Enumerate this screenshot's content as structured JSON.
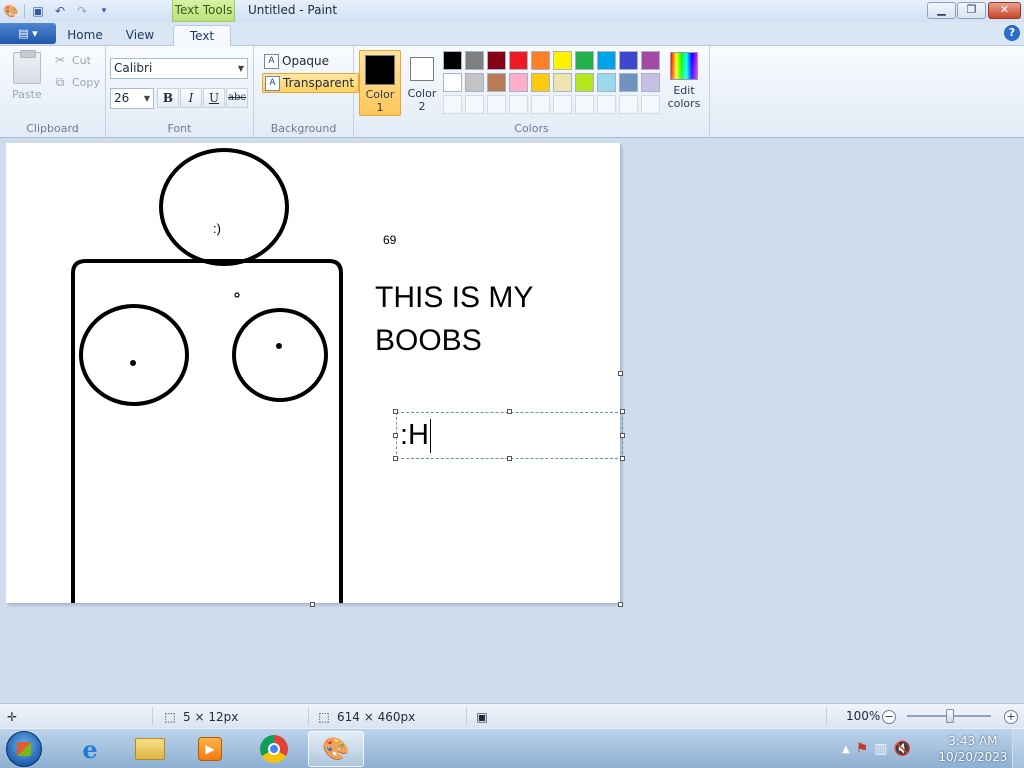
{
  "window": {
    "title": "Untitled - Paint",
    "contextual_tab": "Text Tools"
  },
  "tabs": [
    {
      "label": "Home"
    },
    {
      "label": "View"
    },
    {
      "label": "Text"
    }
  ],
  "ribbon": {
    "clipboard": {
      "label": "Clipboard",
      "paste": "Paste",
      "cut": "Cut",
      "copy": "Copy"
    },
    "font": {
      "label": "Font",
      "family": "Calibri",
      "size": "26",
      "bold": "B",
      "italic": "I",
      "underline": "U",
      "strike": "abc"
    },
    "background": {
      "label": "Background",
      "opaque": "Opaque",
      "transparent": "Transparent"
    },
    "colors": {
      "label": "Colors",
      "color1_label": "Color",
      "color1_num": "1",
      "color2_label": "Color",
      "color2_num": "2",
      "color1_value": "#000000",
      "color2_value": "#ffffff",
      "edit": "Edit",
      "edit2": "colors",
      "palette_row1": [
        "#000000",
        "#7f7f7f",
        "#880015",
        "#ed1c24",
        "#ff7f27",
        "#fff200",
        "#22b14c",
        "#00a2e8",
        "#3f48cc",
        "#a349a4"
      ],
      "palette_row2": [
        "#ffffff",
        "#c3c3c3",
        "#b97a57",
        "#ffaec9",
        "#ffc90e",
        "#efe4b0",
        "#b5e61d",
        "#99d9ea",
        "#7092be",
        "#c8bfe7"
      ]
    }
  },
  "canvas": {
    "smiley": ":)",
    "number": "69",
    "line1": "THIS IS MY",
    "line2": "BOOBS",
    "typed": ":H"
  },
  "status": {
    "selection_size": "5 × 12px",
    "canvas_size": "614 × 460px",
    "zoom": "100%"
  },
  "taskbar": {
    "time": "3:43 AM",
    "date": "10/20/2023"
  }
}
